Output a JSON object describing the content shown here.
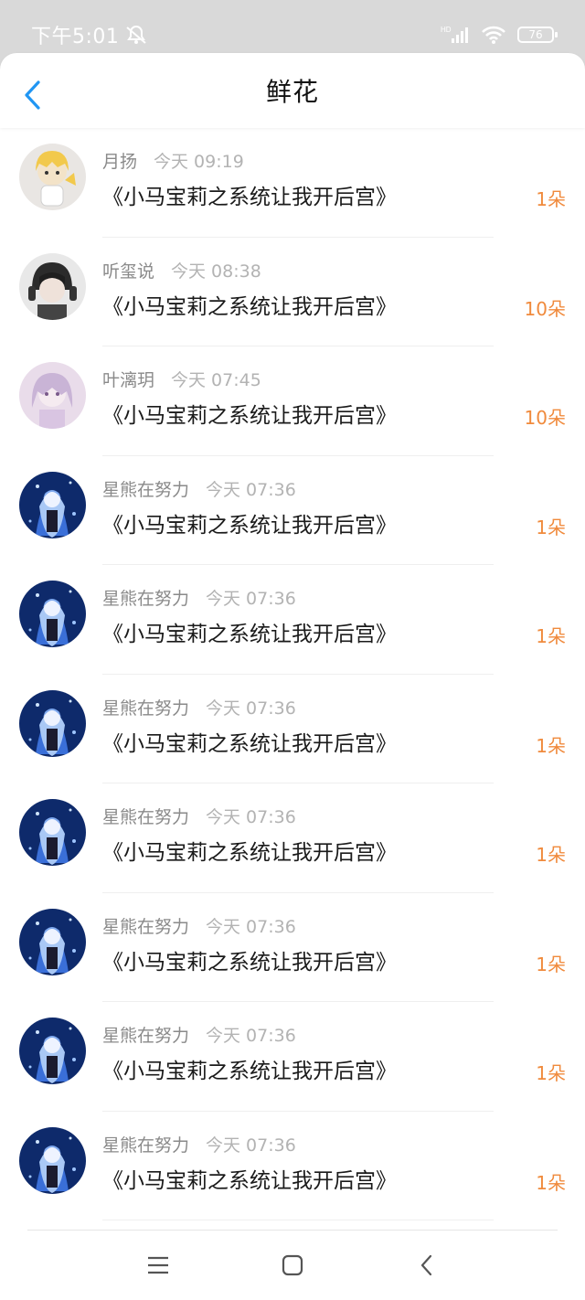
{
  "status_bar": {
    "time": "下午5:01",
    "battery": "76",
    "network_label": "HD",
    "icons": [
      "mute-icon",
      "signal-icon",
      "wifi-icon",
      "battery-icon"
    ]
  },
  "header": {
    "title": "鲜花",
    "back_icon": "chevron-left-icon",
    "accent": "#2196f3"
  },
  "colors": {
    "flower_count": "#f08a3c",
    "name": "#8a8a8a",
    "timestamp": "#b3b3b3"
  },
  "items": [
    {
      "name": "月扬",
      "time": "今天 09:19",
      "title": "《小马宝莉之系统让我开后宫》",
      "count": "1朵",
      "avatar": "blonde-anime-avatar"
    },
    {
      "name": "听玺说",
      "time": "今天 08:38",
      "title": "《小马宝莉之系统让我开后宫》",
      "count": "10朵",
      "avatar": "headphones-boy-avatar"
    },
    {
      "name": "叶漓玥",
      "time": "今天 07:45",
      "title": "《小马宝莉之系统让我开后宫》",
      "count": "10朵",
      "avatar": "purple-anime-girl-avatar"
    },
    {
      "name": "星熊在努力",
      "time": "今天 07:36",
      "title": "《小马宝莉之系统让我开后宫》",
      "count": "1朵",
      "avatar": "blue-anime-girl-avatar"
    },
    {
      "name": "星熊在努力",
      "time": "今天 07:36",
      "title": "《小马宝莉之系统让我开后宫》",
      "count": "1朵",
      "avatar": "blue-anime-girl-avatar"
    },
    {
      "name": "星熊在努力",
      "time": "今天 07:36",
      "title": "《小马宝莉之系统让我开后宫》",
      "count": "1朵",
      "avatar": "blue-anime-girl-avatar"
    },
    {
      "name": "星熊在努力",
      "time": "今天 07:36",
      "title": "《小马宝莉之系统让我开后宫》",
      "count": "1朵",
      "avatar": "blue-anime-girl-avatar"
    },
    {
      "name": "星熊在努力",
      "time": "今天 07:36",
      "title": "《小马宝莉之系统让我开后宫》",
      "count": "1朵",
      "avatar": "blue-anime-girl-avatar"
    },
    {
      "name": "星熊在努力",
      "time": "今天 07:36",
      "title": "《小马宝莉之系统让我开后宫》",
      "count": "1朵",
      "avatar": "blue-anime-girl-avatar"
    },
    {
      "name": "星熊在努力",
      "time": "今天 07:36",
      "title": "《小马宝莉之系统让我开后宫》",
      "count": "1朵",
      "avatar": "blue-anime-girl-avatar"
    }
  ],
  "nav_bar": {
    "icons": [
      "menu-icon",
      "home-icon",
      "back-icon"
    ]
  }
}
